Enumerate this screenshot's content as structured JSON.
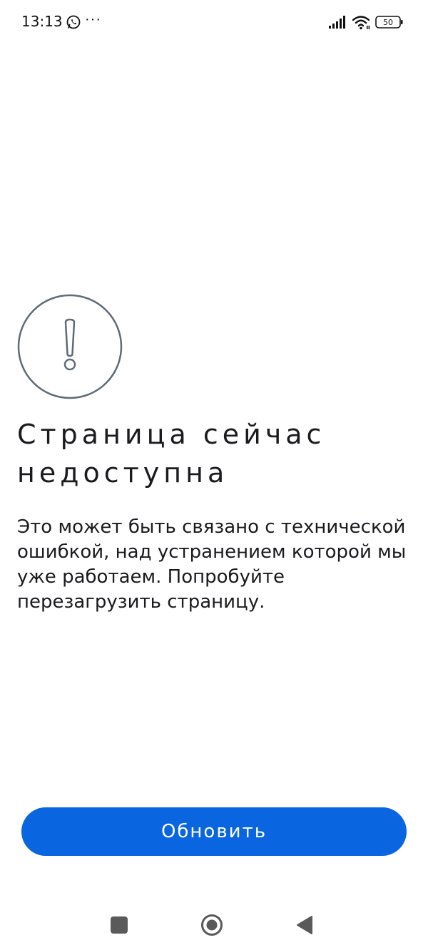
{
  "status_bar": {
    "time": "13:13",
    "more": "···",
    "battery_level": "50",
    "icons": [
      "whatsapp-icon",
      "signal-icon",
      "wifi-icon",
      "battery-icon"
    ]
  },
  "error": {
    "icon": "exclamation-circle-icon",
    "title": "Страница сейчас недоступна",
    "description": "Это может быть связано с технической ошибкой, над устранением которой мы уже работаем. Попробуйте перезагрузить страницу."
  },
  "actions": {
    "refresh_label": "Обновить"
  },
  "nav_bar": {
    "icons": [
      "recents-square-icon",
      "home-circle-icon",
      "back-triangle-icon"
    ]
  },
  "colors": {
    "accent": "#0a66e0",
    "icon_stroke": "#5f6b77",
    "text": "#1b1b1f"
  }
}
